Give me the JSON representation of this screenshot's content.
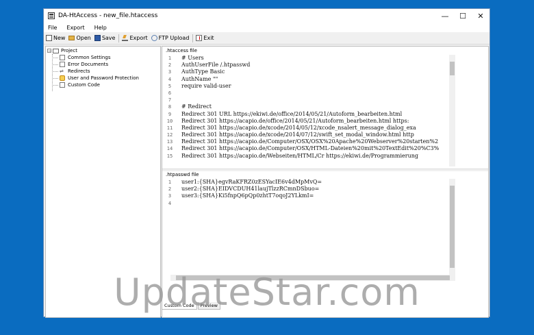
{
  "window": {
    "title": "DA-HtAccess - new_file.htaccess",
    "controls": {
      "minimize": "—",
      "maximize": "☐",
      "close": "✕"
    }
  },
  "menu": [
    "File",
    "Export",
    "Help"
  ],
  "toolbar": {
    "new_label": "New",
    "open_label": "Open",
    "save_label": "Save",
    "export_label": "Export",
    "ftp_label": "FTP Upload",
    "exit_label": "Exit"
  },
  "tree": {
    "expander": "−",
    "root": "Project",
    "items": [
      {
        "label": "Common Settings",
        "icon": "page-icon"
      },
      {
        "label": "Error Documents",
        "icon": "page-icon"
      },
      {
        "label": "Redirects",
        "icon": "redirect-icon",
        "glyph": "⇌"
      },
      {
        "label": "User and Password Protection",
        "icon": "lock-icon"
      },
      {
        "label": "Custom Code",
        "icon": "page-icon"
      }
    ]
  },
  "htaccess": {
    "label": ".htaccess file",
    "line_numbers": [
      "1",
      "2",
      "3",
      "4",
      "5",
      "6",
      "7",
      "8",
      "9",
      "10",
      "11",
      "12",
      "13",
      "14",
      "15"
    ],
    "lines": [
      "# Users",
      "AuthUserFile /.htpasswd",
      "AuthType Basic",
      "AuthName \"\"",
      "require valid-user",
      "",
      "",
      "# Redirect",
      "Redirect 301 URL https://ekiwi.de/office/2014/05/21/Autoform_bearbeiten.html",
      "Redirect 301 https://acapio.de/office/2014/05/21/Autoform_bearbeiten.html https:",
      "Redirect 301 https://acapio.de/xcode/2014/05/12/xcode_nsalert_message_dialog_exa",
      "Redirect 301 https://acapio.de/xcode/2014/07/12/swift_set_modal_window.html http",
      "Redirect 301 https://acapio.de/Computer/OSX/OSX%20Apache%20Webserver%20starten%2",
      "Redirect 301 https://acapio.de/Computer/OSX/HTML-Dateien%20mit%20TextEdit%20%C3%",
      "Redirect 301 https://acapio.de/Webseiten/HTML/Cr https://ekiwi.de/Programmierung"
    ]
  },
  "htpasswd": {
    "label": ".htpasswd file",
    "line_numbers": [
      "1",
      "2",
      "3",
      "4"
    ],
    "lines": [
      "user1:{SHA}egvRaKFRZ0zESYacIE6v4dMpMvQ=",
      "user2:{SHA}EIDVCDUH41laujTlzzRCmnDSbuo=",
      "user3:{SHA}Ki5fnpQ6pQp0zhtT7oqoJ2YLkmI=",
      ""
    ]
  },
  "tabs": [
    "Custom Code",
    "Preview"
  ],
  "watermark": "UpdateStar.com",
  "colors": {
    "desktop": "#0a6cc0",
    "window_bg": "#f0f0f0"
  }
}
